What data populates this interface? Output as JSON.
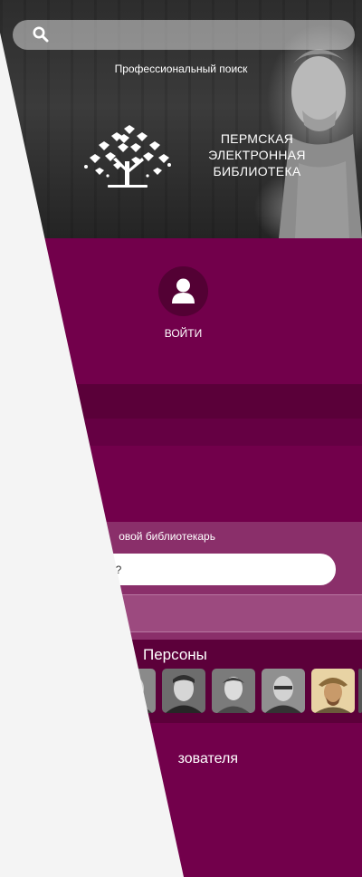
{
  "header": {
    "search_placeholder": "",
    "pro_search_label": "Профессиональный поиск",
    "logo_lines": [
      "ПЕРМСКАЯ",
      "ЭЛЕКТРОННАЯ",
      "БИБЛИОТЕКА"
    ]
  },
  "account": {
    "login_label": "ВОЙТИ"
  },
  "assistant": {
    "title": "овой библиотекарь",
    "input_placeholder": "т! Что хотите найти?"
  },
  "persons": {
    "title": "Персоны"
  },
  "user_section": {
    "title": "зователя"
  },
  "colors": {
    "purple_main": "#72004b",
    "purple_dark": "#5a0039",
    "purple_light": "#8a2f6a",
    "page_background": "#f4f4f4"
  }
}
